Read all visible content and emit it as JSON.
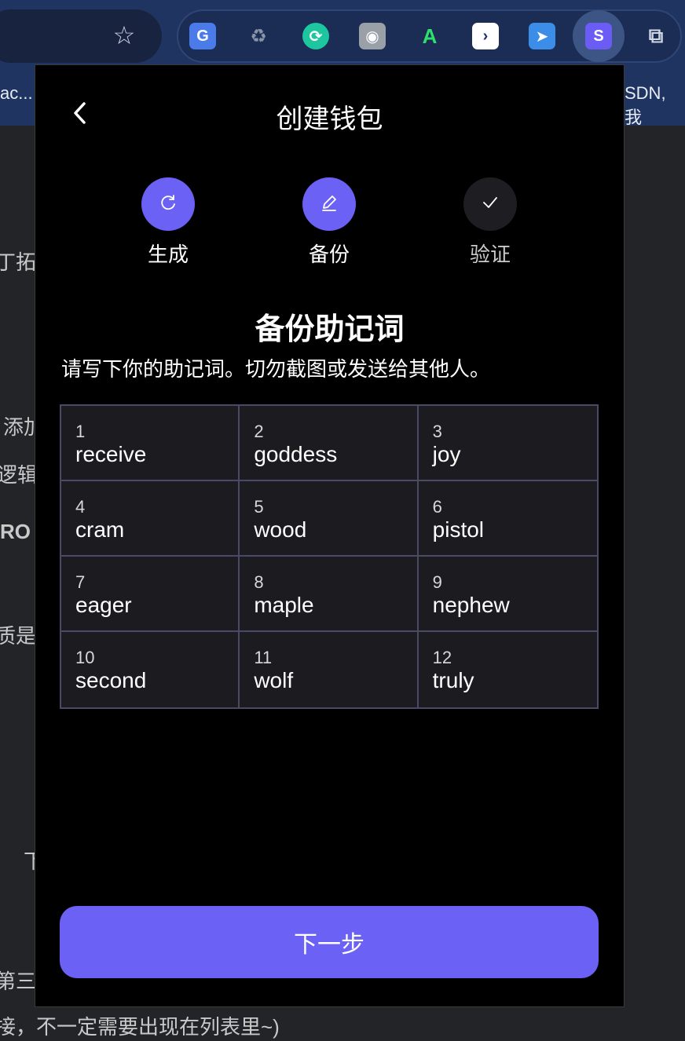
{
  "browser": {
    "bookmark_left": "ac...",
    "bookmark_right": "SDN, 我",
    "extensions": [
      "translate-icon",
      "recycle-icon",
      "sync-icon",
      "camera-icon",
      "a-icon",
      "terminal-icon",
      "send-icon",
      "wallet-extension-icon",
      "puzzle-icon"
    ]
  },
  "background_page": {
    "lines": [
      "丁拓",
      "添加",
      "逻辑",
      "RO",
      "质是",
      "下",
      "第三",
      "接，不一定需要出现在列表里~)"
    ]
  },
  "popup": {
    "title": "创建钱包",
    "steps": [
      {
        "label": "生成",
        "state": "done",
        "icon": "refresh-icon"
      },
      {
        "label": "备份",
        "state": "done",
        "icon": "pencil-icon"
      },
      {
        "label": "验证",
        "state": "todo",
        "icon": "check-icon"
      }
    ],
    "heading": "备份助记词",
    "subtext": "请写下你的助记词。切勿截图或发送给其他人。",
    "mnemonic": [
      {
        "num": "1",
        "word": "receive"
      },
      {
        "num": "2",
        "word": "goddess"
      },
      {
        "num": "3",
        "word": "joy"
      },
      {
        "num": "4",
        "word": "cram"
      },
      {
        "num": "5",
        "word": "wood"
      },
      {
        "num": "6",
        "word": "pistol"
      },
      {
        "num": "7",
        "word": "eager"
      },
      {
        "num": "8",
        "word": "maple"
      },
      {
        "num": "9",
        "word": "nephew"
      },
      {
        "num": "10",
        "word": "second"
      },
      {
        "num": "11",
        "word": "wolf"
      },
      {
        "num": "12",
        "word": "truly"
      }
    ],
    "next_label": "下一步"
  },
  "colors": {
    "accent": "#6b61f5",
    "popup_bg": "#000000",
    "toolbar_bg": "#1f3461"
  }
}
